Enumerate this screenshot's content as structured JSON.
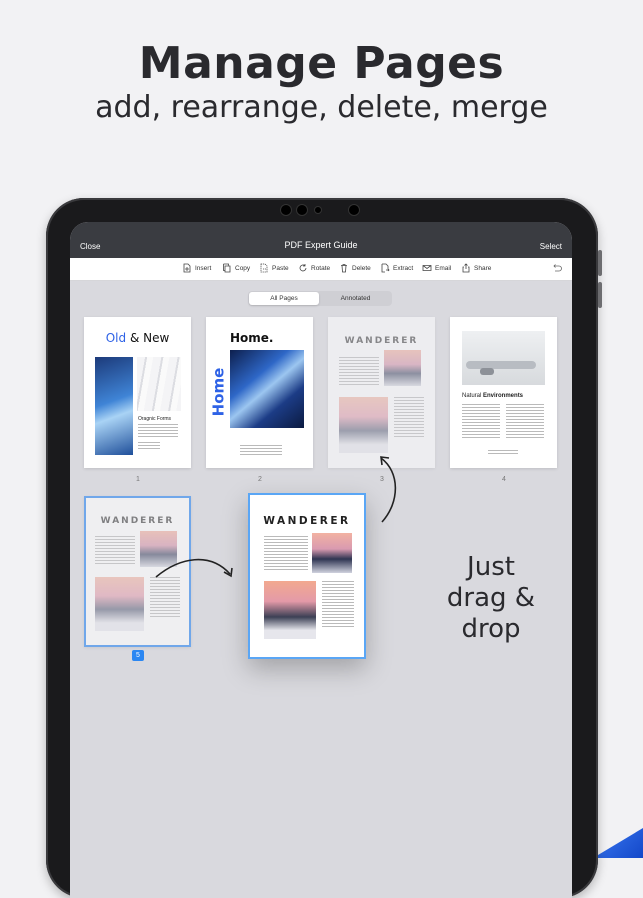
{
  "promo": {
    "title": "Manage Pages",
    "subtitle": "add, rearrange, delete, merge",
    "drag_hint_lines": [
      "Just",
      "drag &",
      "drop"
    ]
  },
  "navbar": {
    "close_label": "Close",
    "title": "PDF Expert Guide",
    "select_label": "Select"
  },
  "toolbar": {
    "items": [
      {
        "label": "Insert",
        "icon": "insert-page-icon"
      },
      {
        "label": "Copy",
        "icon": "copy-icon"
      },
      {
        "label": "Paste",
        "icon": "paste-icon"
      },
      {
        "label": "Rotate",
        "icon": "rotate-icon"
      },
      {
        "label": "Delete",
        "icon": "trash-icon"
      },
      {
        "label": "Extract",
        "icon": "extract-icon"
      },
      {
        "label": "Email",
        "icon": "envelope-icon"
      },
      {
        "label": "Share",
        "icon": "share-icon"
      }
    ],
    "undo_icon": "undo-icon"
  },
  "segments": {
    "all_pages": "All Pages",
    "annotated": "Annotated",
    "selected": "All Pages"
  },
  "pages": {
    "p1": {
      "number": "1",
      "title_accent": "Old",
      "title_rest": "& New",
      "caption": "Oragnic Forms"
    },
    "p2": {
      "number": "2",
      "title": "Home.",
      "side_word": "Home"
    },
    "p3": {
      "number": "3",
      "title": "WANDERER"
    },
    "p4": {
      "number": "4",
      "title_plain": "Natural",
      "title_bold": "Environments"
    },
    "p5": {
      "number": "5",
      "title": "WANDERER"
    },
    "dragged": {
      "title": "WANDERER"
    }
  },
  "colors": {
    "accent_blue": "#2b87f2",
    "navbar": "#3a3c41",
    "title_blue": "#2e62e6"
  }
}
